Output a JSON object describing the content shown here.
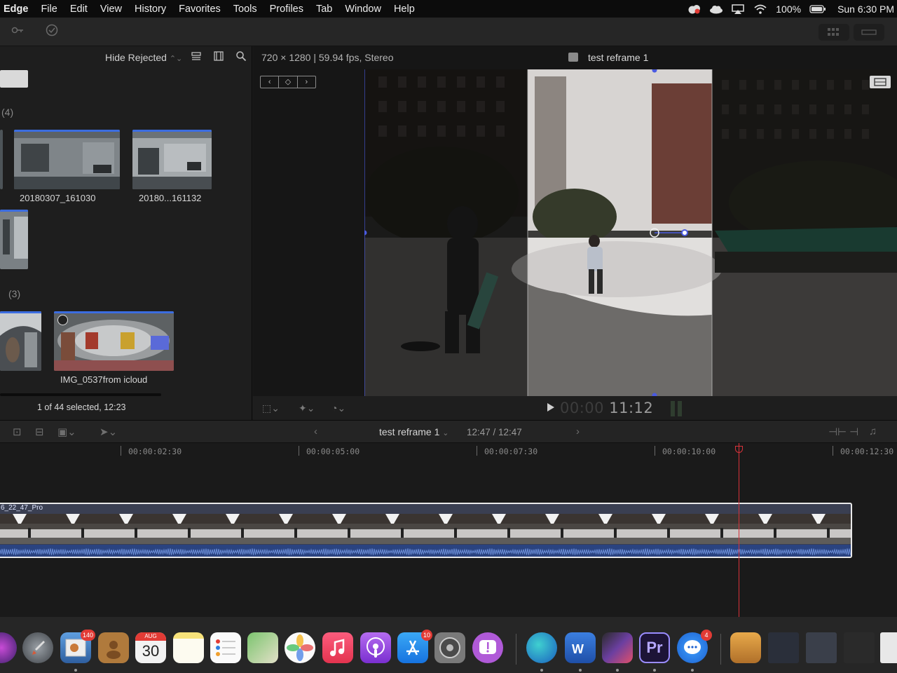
{
  "menubar": {
    "app": "Edge",
    "items": [
      "File",
      "Edit",
      "View",
      "History",
      "Favorites",
      "Tools",
      "Profiles",
      "Tab",
      "Window",
      "Help"
    ],
    "battery": "100%",
    "clock": "Sun 6:30 PM"
  },
  "browser": {
    "filter": "Hide Rejected",
    "group1_count": "(4)",
    "group2_count": "(3)",
    "clips": [
      {
        "label": "20180307_161030"
      },
      {
        "label": "20180...161132"
      },
      {
        "label": "IMG_0537from icloud"
      }
    ],
    "selected_info": "1 of 44 selected, 12:23"
  },
  "viewer": {
    "info": "720 × 1280 | 59.94 fps, Stereo",
    "title": "test reframe 1",
    "timecode_dim": "00:00",
    "timecode": "11:12"
  },
  "timeline": {
    "project": "test reframe 1",
    "duration": "12:47 / 12:47",
    "clip_name": "6_22_47_Pro",
    "ruler": [
      "00:00:02:30",
      "00:00:05:00",
      "00:00:07:30",
      "00:00:10:00",
      "00:00:12:30"
    ]
  },
  "dock": {
    "mail_badge": "140",
    "calendar_month": "AUG",
    "calendar_day": "30",
    "appstore_badge": "10",
    "messenger_badge": "4",
    "premiere_label": "Pr"
  }
}
